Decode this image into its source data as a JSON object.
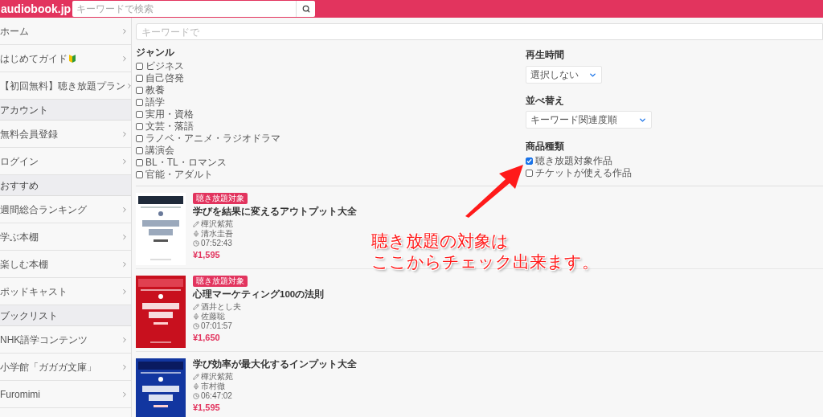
{
  "header": {
    "logo": "audiobook.jp",
    "search_placeholder": "キーワードで検索"
  },
  "sidebar": {
    "items": [
      {
        "kind": "link",
        "label": "ホーム"
      },
      {
        "kind": "link",
        "label": "はじめてガイド",
        "beginner_mark": true
      },
      {
        "kind": "link",
        "label": "【初回無料】聴き放題プラン"
      },
      {
        "kind": "section",
        "label": "アカウント"
      },
      {
        "kind": "link",
        "label": "無料会員登録"
      },
      {
        "kind": "link",
        "label": "ログイン"
      },
      {
        "kind": "section",
        "label": "おすすめ"
      },
      {
        "kind": "link",
        "label": "週間総合ランキング"
      },
      {
        "kind": "link",
        "label": "学ぶ本棚"
      },
      {
        "kind": "link",
        "label": "楽しむ本棚"
      },
      {
        "kind": "link",
        "label": "ポッドキャスト"
      },
      {
        "kind": "section",
        "label": "ブックリスト"
      },
      {
        "kind": "link",
        "label": "NHK語学コンテンツ"
      },
      {
        "kind": "link",
        "label": "小学館「ガガガ文庫」"
      },
      {
        "kind": "link",
        "label": "Furomimi"
      }
    ]
  },
  "filters": {
    "keyword_placeholder": "キーワードで",
    "genre": {
      "title": "ジャンル",
      "options": [
        {
          "label": "ビジネス",
          "checked": false
        },
        {
          "label": "自己啓発",
          "checked": false
        },
        {
          "label": "教養",
          "checked": false
        },
        {
          "label": "語学",
          "checked": false
        },
        {
          "label": "実用・資格",
          "checked": false
        },
        {
          "label": "文芸・落語",
          "checked": false
        },
        {
          "label": "ラノベ・アニメ・ラジオドラマ",
          "checked": false
        },
        {
          "label": "講演会",
          "checked": false
        },
        {
          "label": "BL・TL・ロマンス",
          "checked": false
        },
        {
          "label": "官能・アダルト",
          "checked": false
        }
      ]
    },
    "duration": {
      "title": "再生時間",
      "value": "選択しない"
    },
    "sort": {
      "title": "並べ替え",
      "value": "キーワード関連度順"
    },
    "product_type": {
      "title": "商品種類",
      "options": [
        {
          "label": "聴き放題対象作品",
          "checked": true
        },
        {
          "label": "チケットが使える作品",
          "checked": false
        }
      ]
    }
  },
  "books": [
    {
      "badge": "聴き放題対象",
      "title": "学びを結果に変えるアウトプット大全",
      "author": "樺沢紫苑",
      "narrator": "清水圭吾",
      "duration": "07:52:43",
      "price": "¥1,595"
    },
    {
      "badge": "聴き放題対象",
      "title": "心理マーケティング100の法則",
      "author": "酒井とし夫",
      "narrator": "佐藤聡",
      "duration": "07:01:57",
      "price": "¥1,650"
    },
    {
      "title": "学び効率が最大化するインプット大全",
      "author": "樺沢紫苑",
      "narrator": "市村徹",
      "duration": "06:47:02",
      "price": "¥1,595"
    }
  ],
  "annotation": {
    "lines": [
      "聴き放題の対象は",
      "ここからチェック出来ます。"
    ]
  }
}
